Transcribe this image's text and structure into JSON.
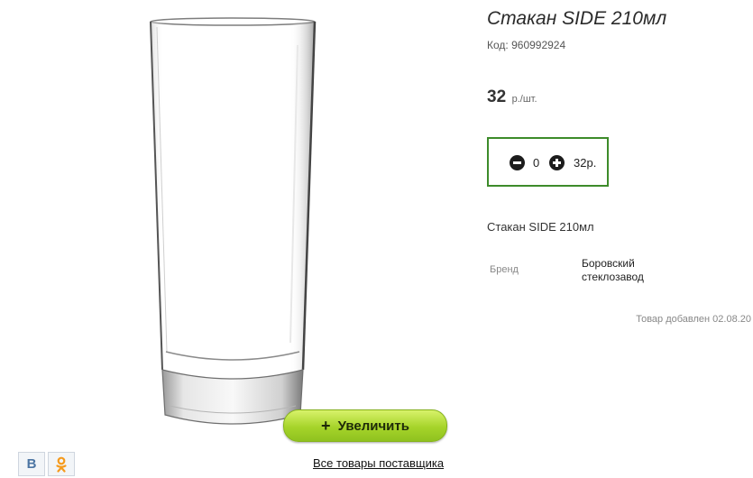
{
  "product": {
    "title": "Стакан SIDE 210мл",
    "code_label": "Код:",
    "code_value": "960992924",
    "price_value": "32",
    "price_unit": "р./шт.",
    "description": "Стакан SIDE 210мл",
    "attributes": [
      {
        "label": "Бренд",
        "value": "Боровский стеклозавод"
      }
    ],
    "added_text": "Товар добавлен 02.08.20"
  },
  "cart": {
    "quantity": "0",
    "total": "32р."
  },
  "gallery": {
    "zoom_label": "Увеличить",
    "zoom_icon": "plus-icon"
  },
  "social": {
    "vk_text": "В",
    "ok_icon": "odnoklassniki-icon"
  },
  "links": {
    "supplier": "Все товары поставщика"
  },
  "colors": {
    "accent_border": "#3d8b2a",
    "zoom_button": "#a6d42a",
    "vk": "#4c75a3",
    "ok": "#f59a1c"
  }
}
